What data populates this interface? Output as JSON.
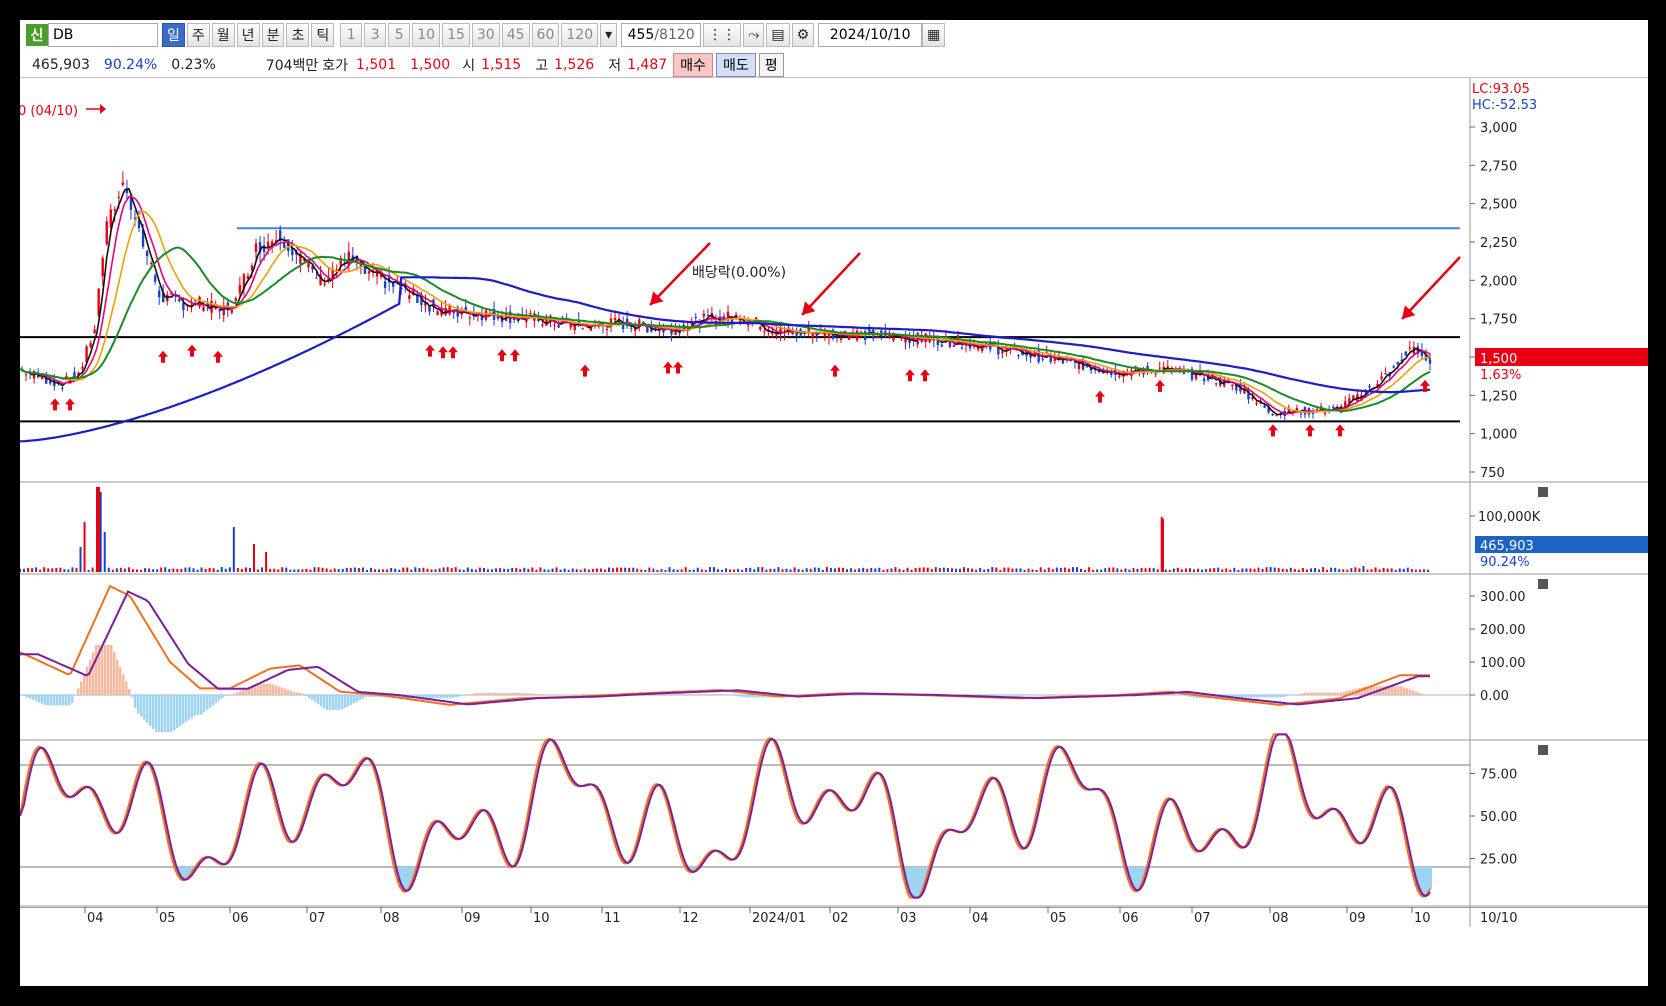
{
  "toolbar": {
    "badge": "신",
    "code": "DB",
    "periods": [
      "일",
      "주",
      "월",
      "년",
      "분",
      "초",
      "틱"
    ],
    "numbers": [
      "1",
      "3",
      "5",
      "10",
      "15",
      "30",
      "45",
      "60",
      "120"
    ],
    "bars_current": "455",
    "bars_total": "/8120",
    "date": "2024/10/10",
    "icons": [
      "chart-type-icon",
      "compare-icon",
      "save-icon",
      "settings-icon",
      "calendar-icon"
    ]
  },
  "quote": {
    "volume": "465,903",
    "vol_ratio": "90.24%",
    "change_pct": "0.23%",
    "amount": "704백만",
    "hoga_label": "호가",
    "ask": "1,501",
    "bid": "1,500",
    "open_label": "시",
    "open": "1,515",
    "high_label": "고",
    "high": "1,526",
    "low_label": "저",
    "low": "1,487",
    "buy": "매수",
    "sell": "매도",
    "avg": "평"
  },
  "price_panel": {
    "lc": "LC:93.05",
    "hc": "HC:-52.53",
    "y_ticks": [
      "3,000",
      "2,750",
      "2,500",
      "2,250",
      "2,000",
      "1,750",
      "1,500",
      "1,250",
      "1,000",
      "750"
    ],
    "y_values": [
      3000,
      2750,
      2500,
      2250,
      2000,
      1750,
      1500,
      1250,
      1000,
      750
    ],
    "current_price": "1,500",
    "current_change": "1.63%",
    "max_label": "0 (04/10)",
    "dividend_note": "배당락(0.00%)",
    "hlines": [
      2340,
      1630,
      1080
    ],
    "line_colors": {
      "price": "#111111",
      "ma5": "#e6007e",
      "ma10": "#f0a000",
      "ma20": "#1a8a2a",
      "ma60": "#1c1cc8",
      "resist": "#3b86d8"
    }
  },
  "volume_panel": {
    "tick": "100,000K",
    "current": "465,903",
    "ratio": "90.24%"
  },
  "macd_panel": {
    "ticks": [
      "300.00",
      "200.00",
      "100.00",
      "0.00"
    ],
    "values": [
      300,
      200,
      100,
      0
    ]
  },
  "stoch_panel": {
    "ticks": [
      "75.00",
      "50.00",
      "25.00"
    ],
    "values": [
      75,
      50,
      25
    ]
  },
  "x_axis": {
    "labels": [
      "04",
      "05",
      "06",
      "07",
      "08",
      "09",
      "10",
      "11",
      "12",
      "2024/01",
      "02",
      "03",
      "04",
      "05",
      "06",
      "07",
      "08",
      "09",
      "10"
    ],
    "last": "10/10"
  }
}
